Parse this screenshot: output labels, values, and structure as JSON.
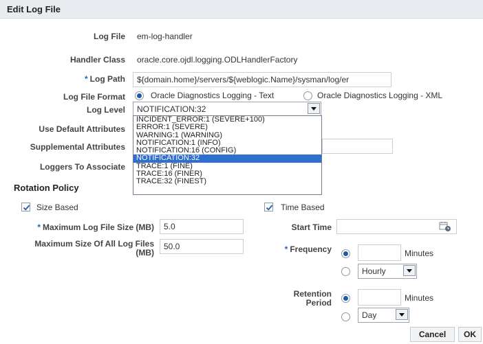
{
  "dialog": {
    "title": "Edit Log File"
  },
  "form": {
    "log_file_label": "Log File",
    "log_file_value": "em-log-handler",
    "handler_class_label": "Handler Class",
    "handler_class_value": "oracle.core.ojdl.logging.ODLHandlerFactory",
    "log_path_label": "Log Path",
    "log_path_value": "${domain.home}/servers/${weblogic.Name}/sysman/log/er",
    "log_file_format_label": "Log File Format",
    "format_option_text": "Oracle Diagnostics Logging - Text",
    "format_option_xml": "Oracle Diagnostics Logging - XML",
    "log_level_label": "Log Level",
    "log_level_value": "NOTIFICATION:32",
    "use_default_attributes_label": "Use Default Attributes",
    "supplemental_attributes_label": "Supplemental Attributes",
    "loggers_to_associate_label": "Loggers To Associate"
  },
  "log_level_options": [
    "INCIDENT_ERROR:1 (SEVERE+100)",
    "ERROR:1 (SEVERE)",
    "WARNING:1 (WARNING)",
    "NOTIFICATION:1 (INFO)",
    "NOTIFICATION:16 (CONFIG)",
    "NOTIFICATION:32",
    "TRACE:1 (FINE)",
    "TRACE:16 (FINER)",
    "TRACE:32 (FINEST)"
  ],
  "rotation": {
    "section_title": "Rotation Policy",
    "size_based_label": "Size Based",
    "max_log_file_size_label": "Maximum Log File Size (MB)",
    "max_log_file_size_value": "5.0",
    "max_size_all_label_1": "Maximum Size Of All Log Files",
    "max_size_all_label_2": "(MB)",
    "max_size_all_value": "50.0",
    "time_based_label": "Time Based",
    "start_time_label": "Start Time",
    "frequency_label": "Frequency",
    "minutes_label": "Minutes",
    "hourly_option": "Hourly",
    "retention_label_1": "Retention",
    "retention_label_2": "Period",
    "retention_minutes_label": "Minutes",
    "day_option": "Day"
  },
  "buttons": {
    "cancel": "Cancel",
    "ok": "OK"
  },
  "required_marker": "*",
  "colors": {
    "accent": "#1e5aa8",
    "selection": "#2f6fd0",
    "titlebar": "#e8ecf1"
  }
}
